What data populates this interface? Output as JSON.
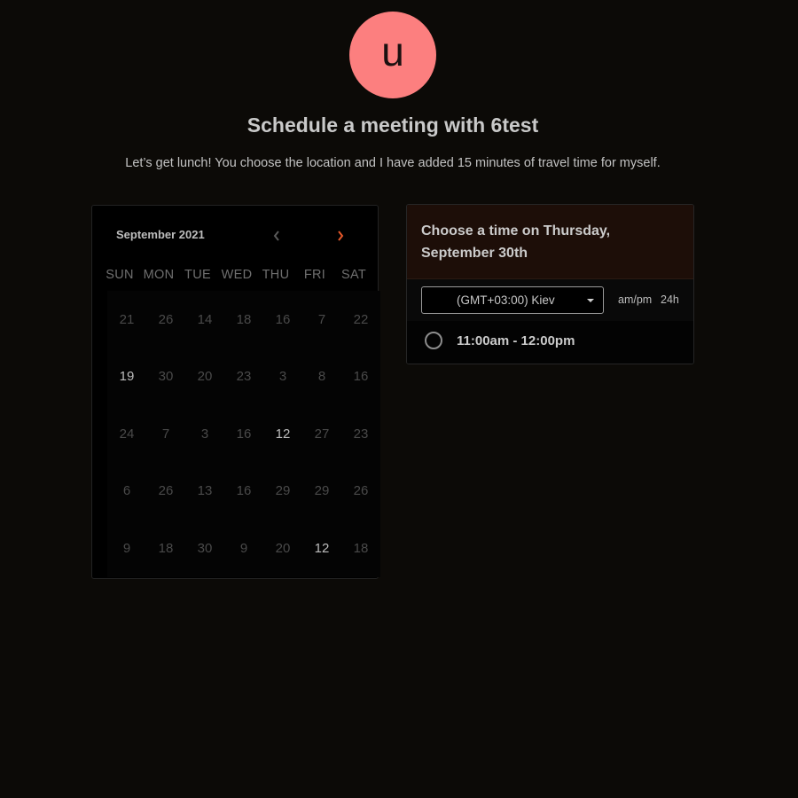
{
  "host": {
    "avatar_letter": "u",
    "avatar_color": "#fc7f7f"
  },
  "title": "Schedule a meeting with 6test",
  "description": "Let’s get lunch! You choose the location and I have added 15 minutes of travel time for myself.",
  "calendar": {
    "month_label": "September 2021",
    "prev_icon": "chevron-left-icon",
    "next_icon": "chevron-right-icon",
    "accent_color": "#e5582a",
    "weekdays": [
      "SUN",
      "MON",
      "TUE",
      "WED",
      "THU",
      "FRI",
      "SAT"
    ],
    "days": [
      {
        "label": "21",
        "available": false
      },
      {
        "label": "26",
        "available": false
      },
      {
        "label": "14",
        "available": false
      },
      {
        "label": "18",
        "available": false
      },
      {
        "label": "16",
        "available": false
      },
      {
        "label": "7",
        "available": false
      },
      {
        "label": "22",
        "available": false
      },
      {
        "label": "19",
        "available": true
      },
      {
        "label": "30",
        "available": false
      },
      {
        "label": "20",
        "available": false
      },
      {
        "label": "23",
        "available": false
      },
      {
        "label": "3",
        "available": false
      },
      {
        "label": "8",
        "available": false
      },
      {
        "label": "16",
        "available": false
      },
      {
        "label": "24",
        "available": false
      },
      {
        "label": "7",
        "available": false
      },
      {
        "label": "3",
        "available": false
      },
      {
        "label": "16",
        "available": false
      },
      {
        "label": "12",
        "available": true
      },
      {
        "label": "27",
        "available": false
      },
      {
        "label": "23",
        "available": false
      },
      {
        "label": "6",
        "available": false
      },
      {
        "label": "26",
        "available": false
      },
      {
        "label": "13",
        "available": false
      },
      {
        "label": "16",
        "available": false
      },
      {
        "label": "29",
        "available": false
      },
      {
        "label": "29",
        "available": false
      },
      {
        "label": "26",
        "available": false
      },
      {
        "label": "9",
        "available": false
      },
      {
        "label": "18",
        "available": false
      },
      {
        "label": "30",
        "available": false
      },
      {
        "label": "9",
        "available": false
      },
      {
        "label": "20",
        "available": false
      },
      {
        "label": "12",
        "available": true
      },
      {
        "label": "18",
        "available": false
      }
    ]
  },
  "time_panel": {
    "heading": "Choose a time on Thursday, September 30th",
    "timezone": {
      "value": "(GMT+03:00) Kiev",
      "caret_icon": "caret-down-icon"
    },
    "format_ampm": "am/pm",
    "format_24h": "24h",
    "slots": [
      {
        "label": "11:00am - 12:00pm"
      }
    ]
  }
}
